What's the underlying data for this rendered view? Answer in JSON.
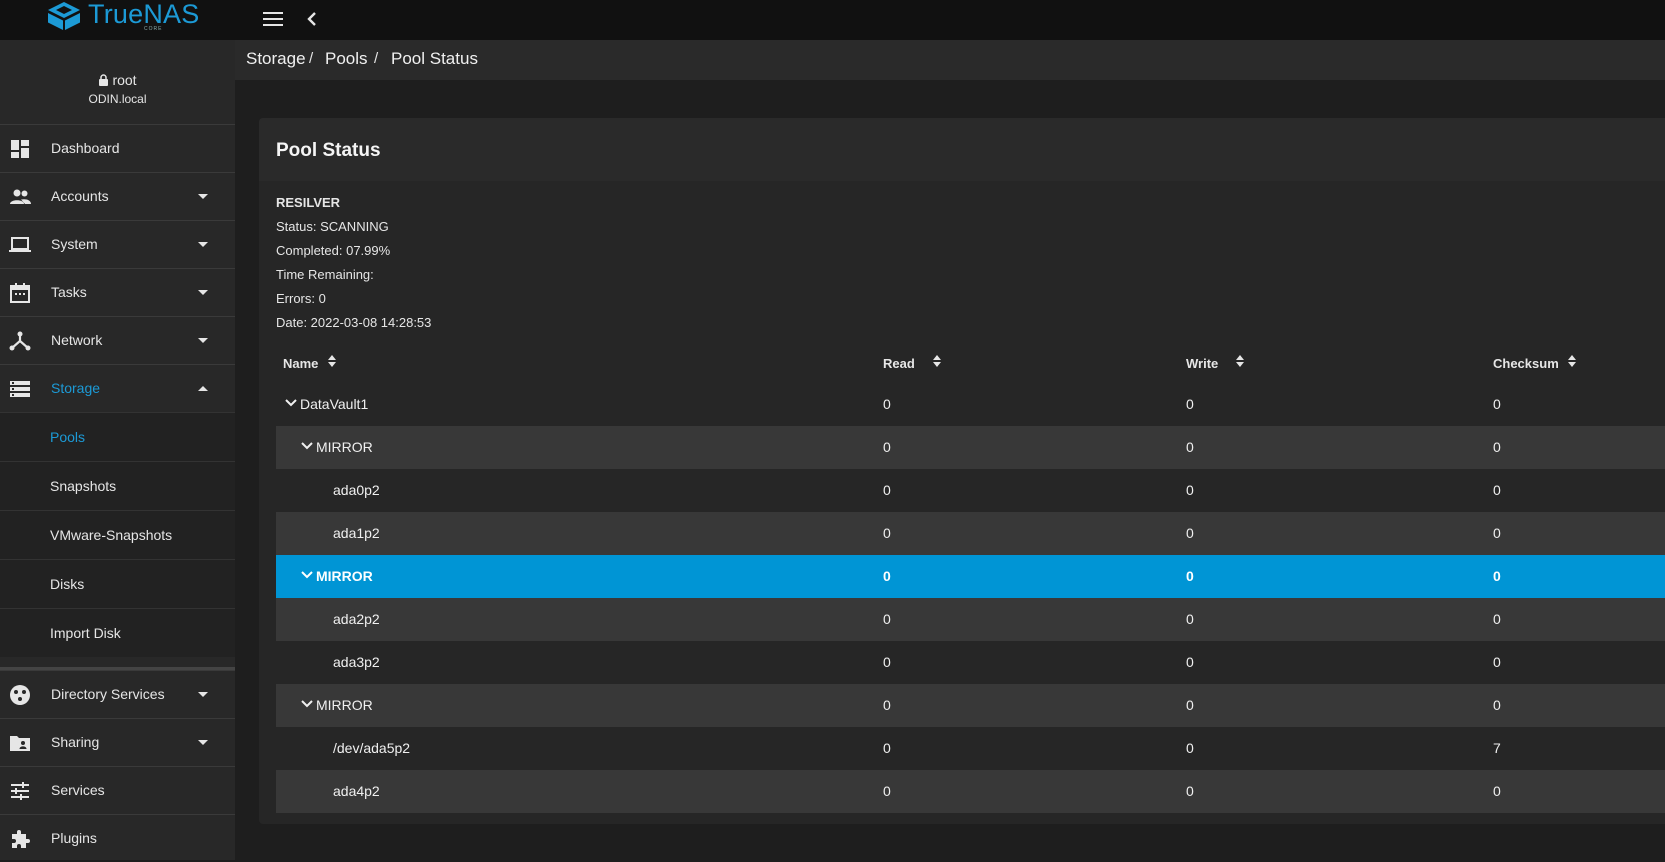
{
  "app": {
    "logo_text": "TrueNAS",
    "logo_sub": "CORE"
  },
  "user": {
    "name": "root",
    "host": "ODIN.local"
  },
  "sidebar": {
    "items": [
      {
        "label": "Dashboard",
        "icon": "dashboard-icon"
      },
      {
        "label": "Accounts",
        "icon": "people-icon"
      },
      {
        "label": "System",
        "icon": "laptop-icon"
      },
      {
        "label": "Tasks",
        "icon": "calendar-icon"
      },
      {
        "label": "Network",
        "icon": "network-icon"
      },
      {
        "label": "Storage",
        "icon": "storage-icon"
      }
    ],
    "storage_sub": [
      {
        "label": "Pools"
      },
      {
        "label": "Snapshots"
      },
      {
        "label": "VMware-Snapshots"
      },
      {
        "label": "Disks"
      },
      {
        "label": "Import Disk"
      }
    ],
    "more_items": [
      {
        "label": "Directory Services",
        "icon": "directory-icon"
      },
      {
        "label": "Sharing",
        "icon": "sharing-folder-icon"
      },
      {
        "label": "Services",
        "icon": "tune-icon"
      },
      {
        "label": "Plugins",
        "icon": "puzzle-icon"
      }
    ]
  },
  "breadcrumb": {
    "items": [
      "Storage",
      "Pools",
      "Pool Status"
    ],
    "sep": "/"
  },
  "card": {
    "title": "Pool Status",
    "scan": {
      "heading": "RESILVER",
      "status": "Status: SCANNING",
      "completed": "Completed: 07.99%",
      "time_remaining": "Time Remaining:",
      "errors": "Errors: 0",
      "date": "Date: 2022-03-08 14:28:53"
    },
    "columns": [
      "Name",
      "Read",
      "Write",
      "Checksum"
    ],
    "rows": [
      {
        "name": "DataVault1",
        "read": "0",
        "write": "0",
        "checksum": "0"
      },
      {
        "name": "MIRROR",
        "read": "0",
        "write": "0",
        "checksum": "0"
      },
      {
        "name": "ada0p2",
        "read": "0",
        "write": "0",
        "checksum": "0"
      },
      {
        "name": "ada1p2",
        "read": "0",
        "write": "0",
        "checksum": "0"
      },
      {
        "name": "MIRROR",
        "read": "0",
        "write": "0",
        "checksum": "0"
      },
      {
        "name": "ada2p2",
        "read": "0",
        "write": "0",
        "checksum": "0"
      },
      {
        "name": "ada3p2",
        "read": "0",
        "write": "0",
        "checksum": "0"
      },
      {
        "name": "MIRROR",
        "read": "0",
        "write": "0",
        "checksum": "0"
      },
      {
        "name": "/dev/ada5p2",
        "read": "0",
        "write": "0",
        "checksum": "7"
      },
      {
        "name": "ada4p2",
        "read": "0",
        "write": "0",
        "checksum": "0"
      }
    ]
  },
  "colors": {
    "accent": "#1c9ad6",
    "selected_row": "#0095d5",
    "topbar": "#111111",
    "sidebar": "#282828"
  }
}
